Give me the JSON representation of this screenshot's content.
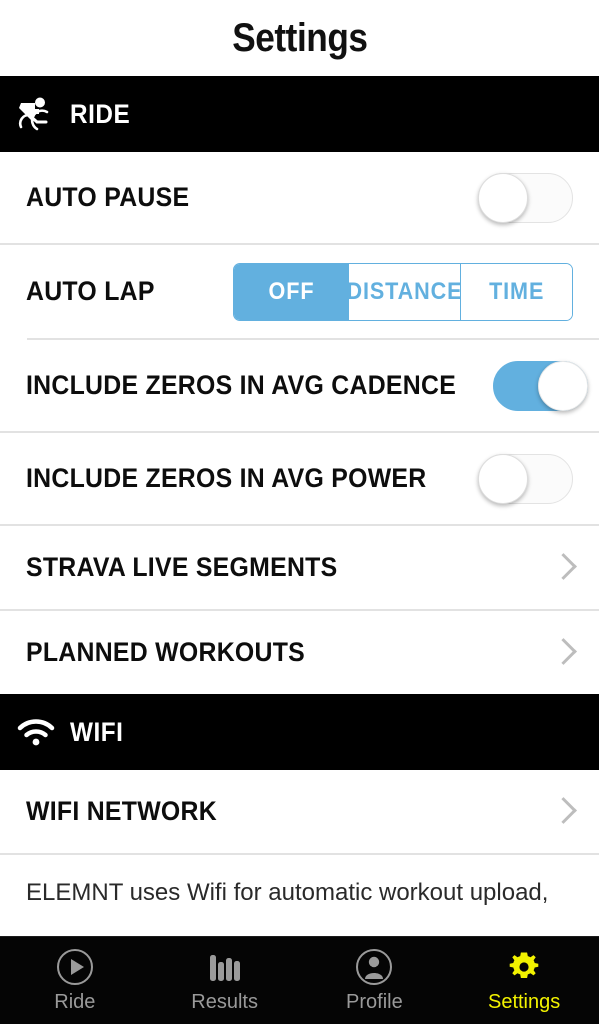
{
  "header": {
    "title": "Settings"
  },
  "sections": [
    {
      "id": "ride",
      "title": "RIDE",
      "icon": "cyclist-icon",
      "rows": [
        {
          "type": "toggle",
          "label": "AUTO PAUSE",
          "value": "off"
        },
        {
          "type": "segmented",
          "label": "AUTO LAP",
          "options": [
            "OFF",
            "DISTANCE",
            "TIME"
          ],
          "selected": "OFF"
        },
        {
          "type": "toggle",
          "label": "INCLUDE ZEROS IN AVG CADENCE",
          "value": "on"
        },
        {
          "type": "toggle",
          "label": "INCLUDE ZEROS IN AVG POWER",
          "value": "off"
        },
        {
          "type": "link",
          "label": "STRAVA LIVE SEGMENTS"
        },
        {
          "type": "link",
          "label": "PLANNED WORKOUTS"
        }
      ]
    },
    {
      "id": "wifi",
      "title": "WIFI",
      "icon": "wifi-icon",
      "rows": [
        {
          "type": "link",
          "label": "WIFI NETWORK"
        }
      ],
      "footnote": "ELEMNT uses Wifi for automatic workout upload,"
    }
  ],
  "tabbar": {
    "tabs": [
      {
        "id": "ride",
        "label": "Ride",
        "icon": "play-circle-icon",
        "active": false
      },
      {
        "id": "results",
        "label": "Results",
        "icon": "bar-chart-icon",
        "active": false
      },
      {
        "id": "profile",
        "label": "Profile",
        "icon": "person-circle-icon",
        "active": false
      },
      {
        "id": "settings",
        "label": "Settings",
        "icon": "gear-icon",
        "active": true
      }
    ]
  },
  "colors": {
    "accent_blue": "#62b0df",
    "active_yellow": "#f2f200",
    "section_header_bg": "#000000",
    "tabbar_bg": "#050505",
    "divider": "#e2e2e2",
    "chevron": "#bdbdbd",
    "inactive_tab": "#9a9a9a"
  }
}
